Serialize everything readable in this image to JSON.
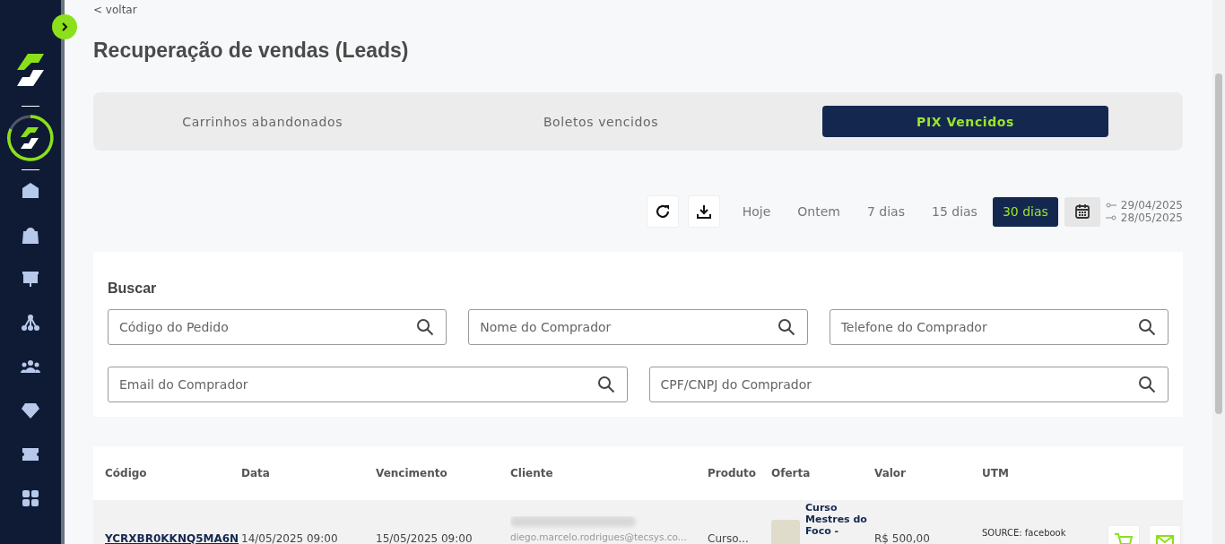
{
  "back_link": "< voltar",
  "title": "Recuperação de vendas (Leads)",
  "tabs": [
    {
      "label": "Carrinhos abandonados",
      "selected": false
    },
    {
      "label": "Boletos vencidos",
      "selected": false
    },
    {
      "label": "PIX Vencidos",
      "selected": true
    }
  ],
  "periods": [
    {
      "label": "Hoje",
      "selected": false
    },
    {
      "label": "Ontem",
      "selected": false
    },
    {
      "label": "7 dias",
      "selected": false
    },
    {
      "label": "15 dias",
      "selected": false
    },
    {
      "label": "30 dias",
      "selected": true
    }
  ],
  "date_range": {
    "start": "29/04/2025",
    "end": "28/05/2025"
  },
  "search": {
    "title": "Buscar",
    "fields": [
      {
        "placeholder": "Código do Pedido"
      },
      {
        "placeholder": "Nome do Comprador"
      },
      {
        "placeholder": "Telefone do Comprador"
      },
      {
        "placeholder": "Email do Comprador"
      },
      {
        "placeholder": "CPF/CNPJ do Comprador"
      }
    ]
  },
  "table": {
    "columns": [
      "Código",
      "Data",
      "Vencimento",
      "Cliente",
      "Produto",
      "Oferta",
      "Valor",
      "UTM"
    ],
    "rows": [
      {
        "code": "YCRXBR0KKNQ5MA6N",
        "date": "14/05/2025 09:00",
        "due": "15/05/2025 09:00",
        "client_email": "diego.marcelo.rodrigues@tecsys.co...",
        "product": "Curso...",
        "offer": "Curso Mestres do Foco -",
        "value": "R$ 500,00",
        "utm": "SOURCE: facebook"
      }
    ]
  }
}
